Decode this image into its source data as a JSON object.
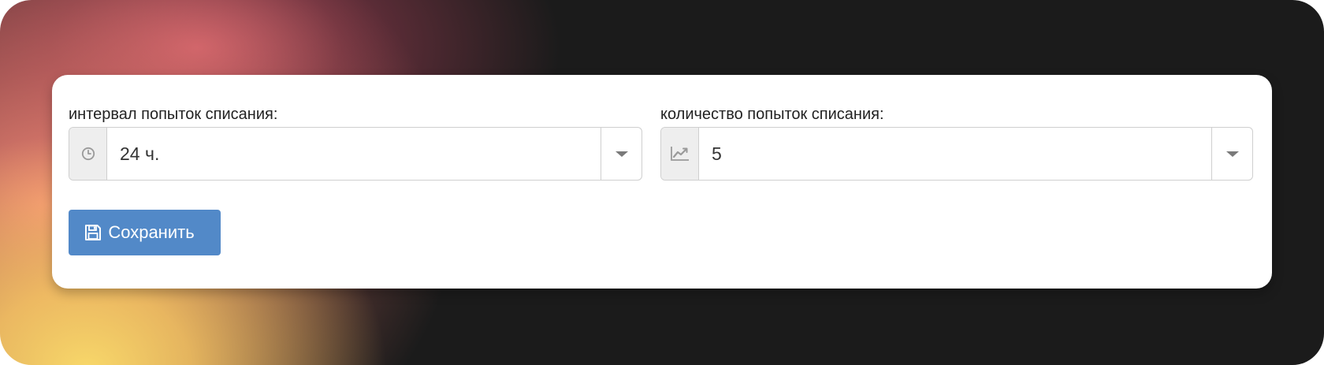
{
  "form": {
    "interval": {
      "label": "интервал попыток списания:",
      "value": "24 ч.",
      "icon": "clock-icon"
    },
    "attempts": {
      "label": "количество попыток списания:",
      "value": "5",
      "icon": "line-chart-icon"
    },
    "save_button": {
      "label": "Сохранить",
      "icon": "floppy-disk-icon"
    }
  },
  "colors": {
    "primary": "#5289c8",
    "border": "#cfcfcf",
    "addon_background": "#eeeeee",
    "text": "#222222",
    "icon_gray": "#9a9a9a"
  }
}
